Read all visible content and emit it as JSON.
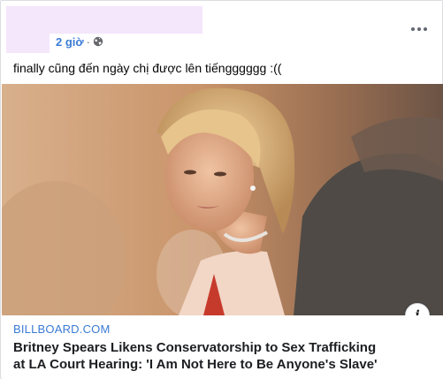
{
  "post": {
    "timestamp": "2 giờ",
    "separator": "·",
    "audience_icon": "globe-icon",
    "more_icon": "more-horizontal-icon",
    "text": "finally cũng đến ngày chị được lên tiếngggggg :(("
  },
  "link_preview": {
    "domain": "BILLBOARD.COM",
    "title": "Britney Spears Likens Conservatorship to Sex Trafficking at LA Court Hearing: 'I Am Not Here to Be Anyone's Slave'",
    "info_icon": "info-icon",
    "info_label": "i"
  },
  "colors": {
    "accent_blue": "#3a7bd5",
    "redaction": "#f4e6fb",
    "border": "#dadde1"
  }
}
